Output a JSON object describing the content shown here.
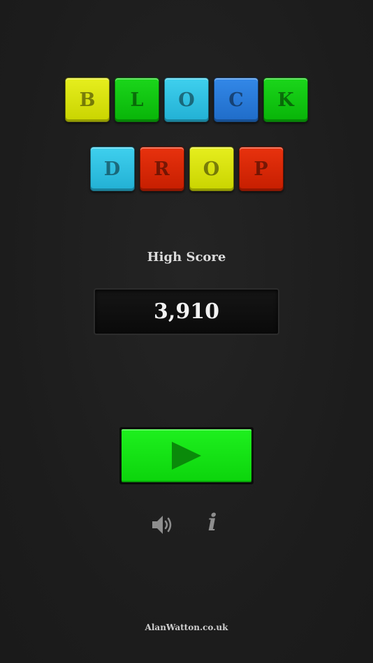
{
  "title": {
    "word1": [
      "B",
      "L",
      "O",
      "C",
      "K"
    ],
    "word2": [
      "D",
      "R",
      "O",
      "P"
    ],
    "word1_colors": [
      "yellow",
      "green",
      "cyan",
      "blue",
      "green"
    ],
    "word2_colors": [
      "cyan",
      "red",
      "yellow",
      "red"
    ]
  },
  "high_score": {
    "label": "High Score",
    "value": "3,910"
  },
  "controls": {
    "play_icon": "play-icon",
    "sound_icon": "speaker-icon",
    "info_icon": "info-icon",
    "info_glyph": "i"
  },
  "colors": {
    "background": "#1e1e1e",
    "play_green": "#12e012"
  },
  "footer": {
    "credit": "AlanWatton.co.uk"
  }
}
